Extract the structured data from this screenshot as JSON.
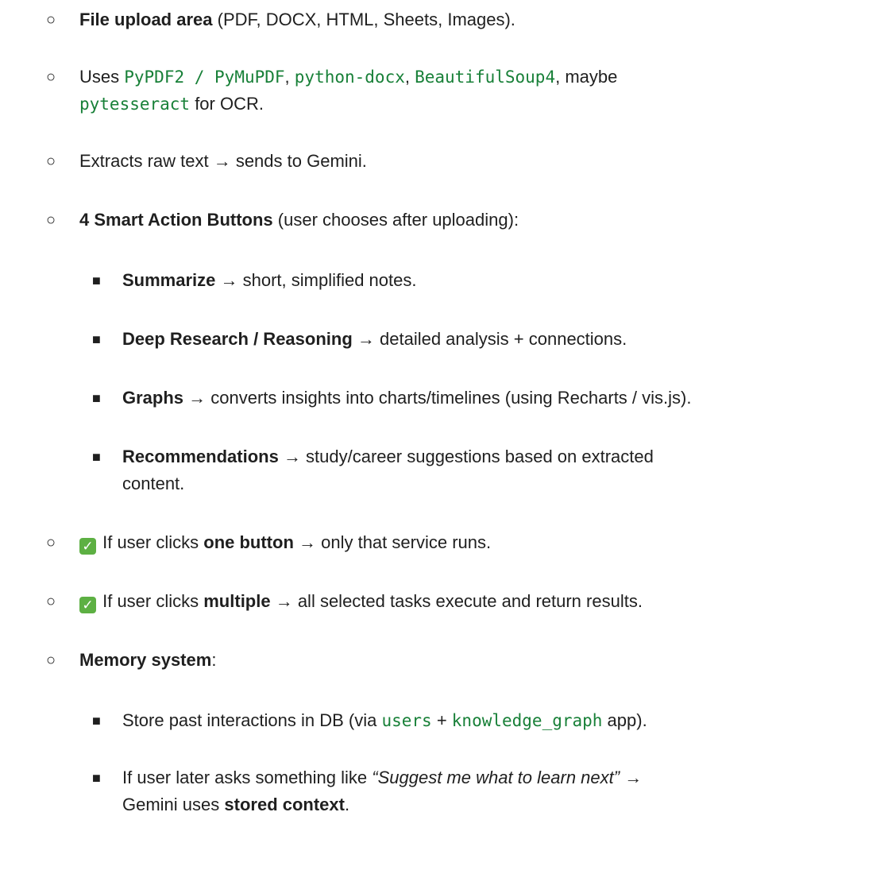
{
  "items": [
    {
      "level": 1,
      "bold": "File upload area",
      "rest": " (PDF, DOCX, HTML, Sheets, Images)."
    },
    {
      "level": 1,
      "pre": "Uses ",
      "code1": "PyPDF2 / PyMuPDF",
      "sep1": ", ",
      "code2": "python-docx",
      "sep2": ", ",
      "code3": "BeautifulSoup4",
      "post": ", maybe",
      "code4": "pytesseract",
      "post2": " for OCR."
    },
    {
      "level": 1,
      "text": "Extracts raw text → sends to Gemini."
    },
    {
      "level": 1,
      "bold": "4 Smart Action Buttons",
      "rest": " (user chooses after uploading):"
    },
    {
      "level": 2,
      "bold": "Summarize",
      "rest": " → short, simplified notes."
    },
    {
      "level": 2,
      "bold": "Deep Research / Reasoning",
      "rest": " → detailed analysis + connections."
    },
    {
      "level": 2,
      "bold": "Graphs",
      "rest": " → converts insights into charts/timelines (using Recharts / vis.js)."
    },
    {
      "level": 2,
      "bold": "Recommendations",
      "rest": " → study/career suggestions based on extracted",
      "line2": "content."
    },
    {
      "level": 1,
      "check": "✓",
      "pre": " If user clicks ",
      "bold": "one button",
      "rest": " → only that service runs."
    },
    {
      "level": 1,
      "check": "✓",
      "pre": " If user clicks ",
      "bold": "multiple",
      "rest": " → all selected tasks execute and return results."
    },
    {
      "level": 1,
      "bold": "Memory system",
      "rest": ":"
    },
    {
      "level": 2,
      "pre": "Store past interactions in DB (via ",
      "code1": "users",
      "sep1": " + ",
      "code2": "knowledge_graph",
      "post": " app)."
    },
    {
      "level": 2,
      "pre": "If user later asks something like ",
      "italic": "“Suggest me what to learn next”",
      "mid": " →",
      "pre2": "Gemini uses ",
      "bold": "stored context",
      "post": "."
    }
  ],
  "bullets": {
    "circle": "○",
    "square": "■"
  }
}
